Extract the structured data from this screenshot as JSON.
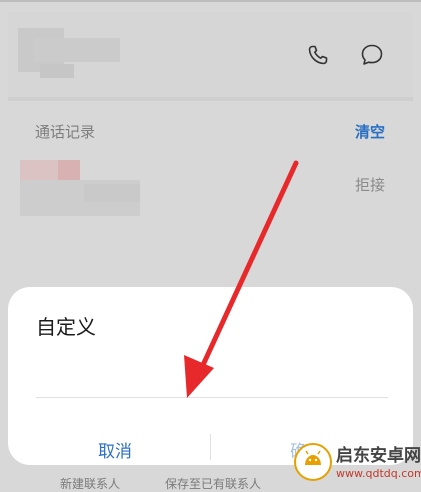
{
  "call_records": {
    "section_title": "通话记录",
    "clear_label": "清空",
    "record_status": "拒接"
  },
  "bottom_toolbar": {
    "new_contact_label": "新建联系人",
    "save_existing_label": "保存至已有联系人"
  },
  "dialog": {
    "title": "自定义",
    "input_value": "",
    "cancel_label": "取消",
    "confirm_label": "确"
  },
  "watermark": {
    "name": "启东安卓网",
    "url": "www.qdtdq.com"
  },
  "icons": {
    "call": "phone-icon",
    "message": "chat-bubble-icon"
  },
  "colors": {
    "link_blue": "#2b6fc4",
    "annotation_red": "#e8292b"
  }
}
